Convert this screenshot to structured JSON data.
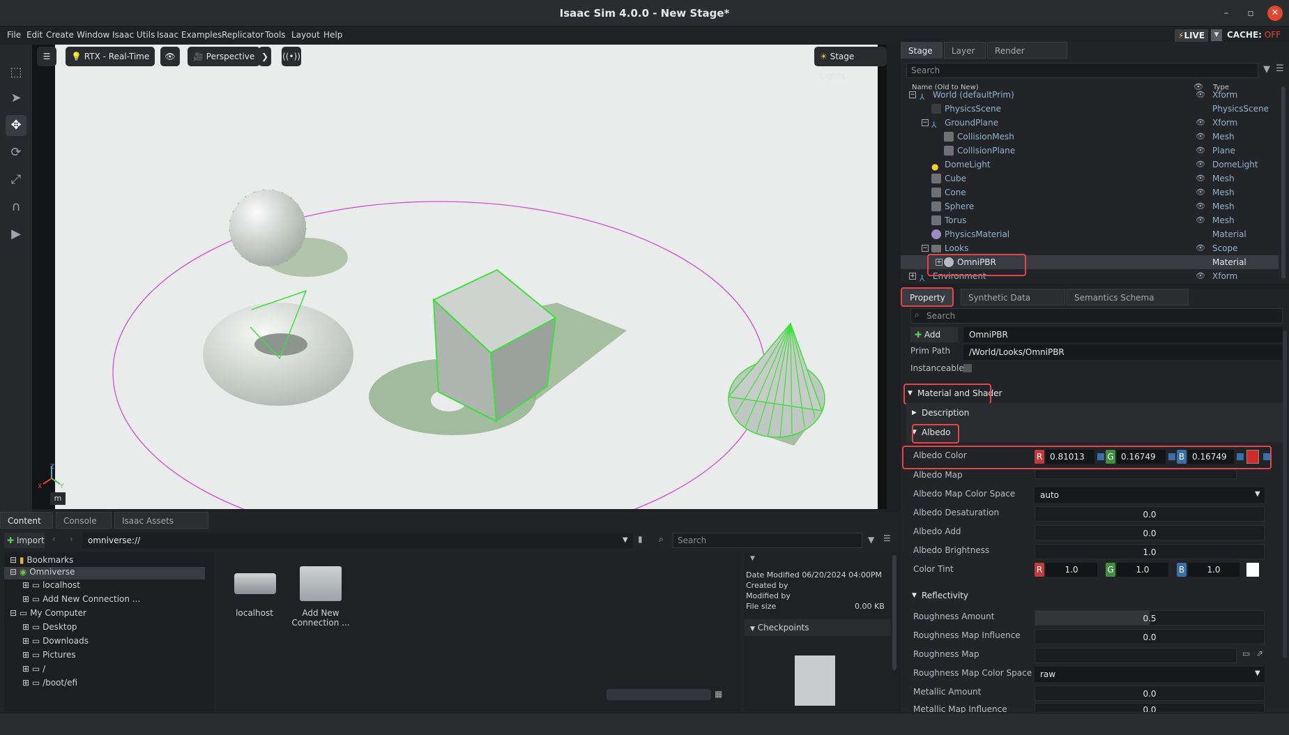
{
  "window": {
    "title": "Isaac Sim 4.0.0 - New Stage*",
    "min": "–",
    "max": "▫",
    "close": "✕"
  },
  "menu": [
    "File",
    "Edit",
    "Create",
    "Window",
    "Isaac Utils",
    "Isaac Examples",
    "Replicator",
    "Tools",
    "Layout",
    "Help"
  ],
  "live": {
    "label": "LIVE",
    "cache_label": "CACHE:",
    "cache_state": "OFF"
  },
  "viewport": {
    "render_mode": "RTX - Real-Time",
    "camera": "Perspective",
    "lights": "Stage Lights",
    "unit": "m",
    "axis_x": "X",
    "axis_y": "Y",
    "axis_z": "Z"
  },
  "stage": {
    "tabs": [
      "Stage",
      "Layer",
      "Render Settings"
    ],
    "search_placeholder": "Search",
    "col_name": "Name (Old to New)",
    "col_type": "Type",
    "rows": [
      {
        "name": "World (defaultPrim)",
        "type": "Xform"
      },
      {
        "name": "PhysicsScene",
        "type": "PhysicsScene"
      },
      {
        "name": "GroundPlane",
        "type": "Xform"
      },
      {
        "name": "CollisionMesh",
        "type": "Mesh"
      },
      {
        "name": "CollisionPlane",
        "type": "Plane"
      },
      {
        "name": "DomeLight",
        "type": "DomeLight"
      },
      {
        "name": "Cube",
        "type": "Mesh"
      },
      {
        "name": "Cone",
        "type": "Mesh"
      },
      {
        "name": "Sphere",
        "type": "Mesh"
      },
      {
        "name": "Torus",
        "type": "Mesh"
      },
      {
        "name": "PhysicsMaterial",
        "type": "Material"
      },
      {
        "name": "Looks",
        "type": "Scope"
      },
      {
        "name": "OmniPBR",
        "type": "Material"
      },
      {
        "name": "Environment",
        "type": "Xform"
      }
    ]
  },
  "property": {
    "tabs": [
      "Property",
      "Synthetic Data Recorder",
      "Semantics Schema Editor"
    ],
    "search_placeholder": "Search",
    "add_label": "Add",
    "prim_name": "OmniPBR",
    "prim_path_label": "Prim Path",
    "prim_path": "/World/Looks/OmniPBR",
    "instanceable_label": "Instanceable",
    "section_material": "Material and Shader",
    "section_description": "Description",
    "section_albedo": "Albedo",
    "albedo_color_label": "Albedo Color",
    "albedo_r": "0.81013",
    "albedo_g": "0.16749",
    "albedo_b": "0.16749",
    "albedo_swatch": "#d22a2a",
    "albedo_map_label": "Albedo Map",
    "albedo_map_cs_label": "Albedo Map Color Space",
    "albedo_map_cs": "auto",
    "albedo_desat_label": "Albedo Desaturation",
    "albedo_desat": "0.0",
    "albedo_add_label": "Albedo Add",
    "albedo_add": "0.0",
    "albedo_bright_label": "Albedo Brightness",
    "albedo_bright": "1.0",
    "color_tint_label": "Color Tint",
    "tint_r": "1.0",
    "tint_g": "1.0",
    "tint_b": "1.0",
    "section_reflect": "Reflectivity",
    "rough_amount_label": "Roughness Amount",
    "rough_amount": "0.5",
    "rough_map_inf_label": "Roughness Map Influence",
    "rough_map_inf": "0.0",
    "rough_map_label": "Roughness Map",
    "rough_map_cs_label": "Roughness Map Color Space",
    "rough_map_cs": "raw",
    "metallic_amount_label": "Metallic Amount",
    "metallic_amount": "0.0",
    "metallic_map_inf_label": "Metallic Map Influence",
    "metallic_map_inf": "0.0",
    "ch_r": "R",
    "ch_g": "G",
    "ch_b": "B"
  },
  "content": {
    "tabs": [
      "Content",
      "Console",
      "Isaac Assets (Beta)"
    ],
    "import_label": "Import",
    "path": "omniverse://",
    "search_placeholder": "Search",
    "tree": [
      "Bookmarks",
      "Omniverse",
      "localhost",
      "Add New Connection ...",
      "My Computer",
      "Desktop",
      "Downloads",
      "Pictures",
      "/",
      "/boot/efi"
    ],
    "items": [
      {
        "label": "localhost"
      },
      {
        "label": "Add New Connection ..."
      }
    ],
    "info": {
      "date_modified": "Date Modified 06/20/2024 04:00PM",
      "created_by": "Created by",
      "modified_by": "Modified by",
      "file_size_label": "File size",
      "file_size": "0.00 KB",
      "checkpoints": "Checkpoints"
    }
  },
  "colors": {
    "accent_highlight": "#e0474c",
    "selection_green": "#3ee03a",
    "live_red": "#e0482f"
  }
}
